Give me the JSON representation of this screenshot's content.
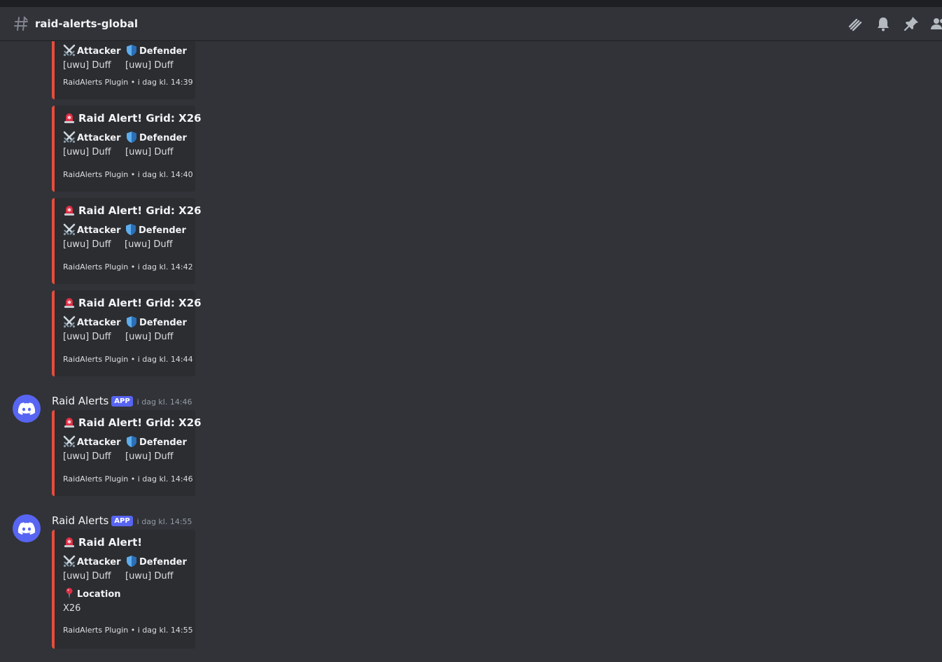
{
  "channel": {
    "name": "raid-alerts-global"
  },
  "header_icons": [
    "threads-icon",
    "bell-icon",
    "pin-icon",
    "members-icon"
  ],
  "colors": {
    "embed_accent": "#e74c3c",
    "app_badge": "#5865f2",
    "background": "#313338",
    "embed_bg": "#2b2d31"
  },
  "labels": {
    "attacker": "Attacker",
    "defender": "Defender",
    "location": "Location",
    "username": "Raid Alerts",
    "app_badge": "APP"
  },
  "embeds": [
    {
      "title": "",
      "attacker": "[uwu] Duff",
      "defender": "[uwu] Duff",
      "footer": "RaidAlerts Plugin • i dag kl. 14:39"
    },
    {
      "title": "Raid Alert! Grid: X26",
      "attacker": "[uwu] Duff",
      "defender": "[uwu] Duff",
      "footer": "RaidAlerts Plugin • i dag kl. 14:40"
    },
    {
      "title": "Raid Alert! Grid: X26",
      "attacker": "[uwu] Duff",
      "defender": "[uwu] Duff",
      "footer": "RaidAlerts Plugin • i dag kl. 14:42"
    },
    {
      "title": "Raid Alert! Grid: X26",
      "attacker": "[uwu] Duff",
      "defender": "[uwu] Duff",
      "footer": "RaidAlerts Plugin • i dag kl. 14:44"
    },
    {
      "title": "Raid Alert! Grid: X26",
      "attacker": "[uwu] Duff",
      "defender": "[uwu] Duff",
      "footer": "RaidAlerts Plugin • i dag kl. 14:46"
    },
    {
      "title": "Raid Alert!",
      "attacker": "[uwu] Duff",
      "defender": "[uwu] Duff",
      "location": "X26",
      "footer": "RaidAlerts Plugin • i dag kl. 14:55"
    }
  ],
  "messages": [
    {
      "timestamp": "i dag kl. 14:46"
    },
    {
      "timestamp": "i dag kl. 14:55"
    }
  ]
}
